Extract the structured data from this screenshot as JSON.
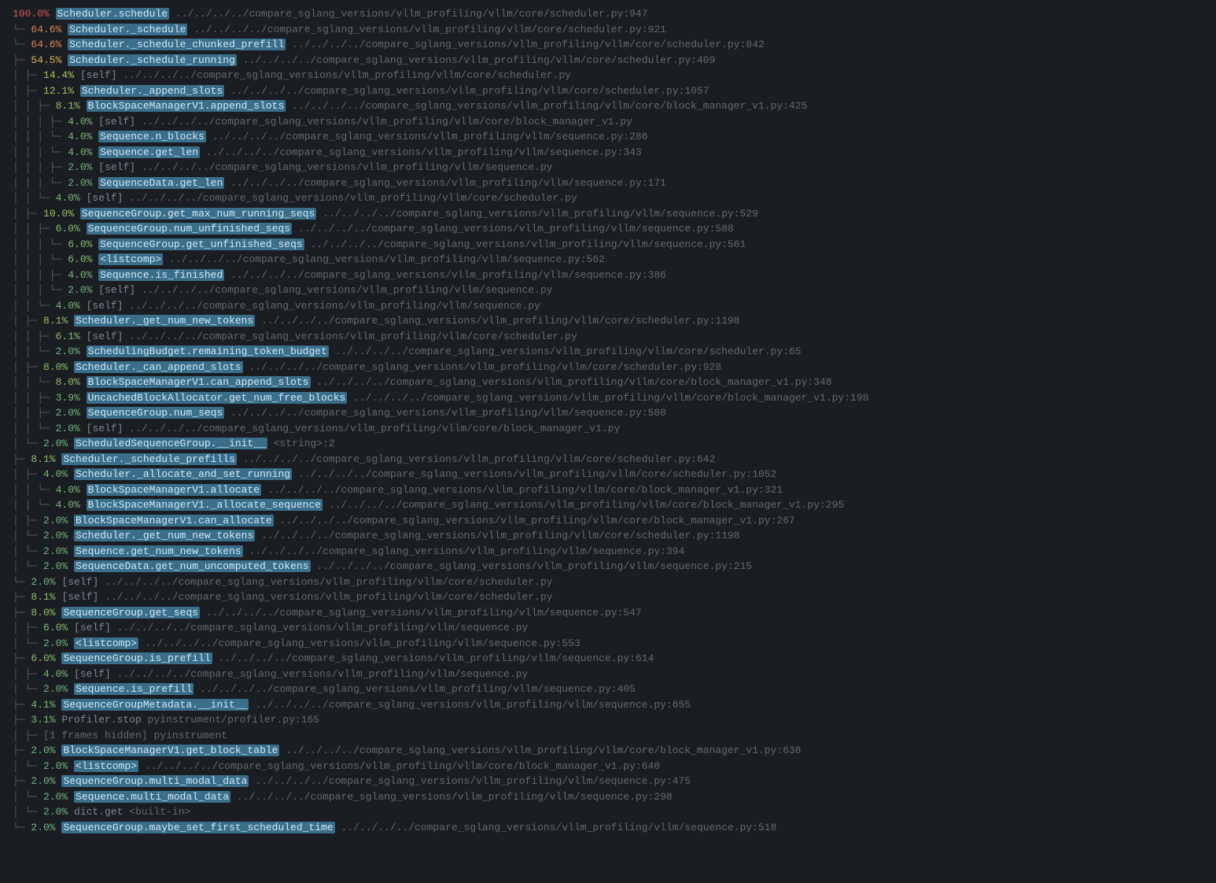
{
  "colors": {
    "pct_100": "#d1565a",
    "pct_64": "#d78a52",
    "pct_54": "#d7ae52",
    "pct_14": "#a7c25c",
    "pct_12": "#a0c160",
    "pct_10": "#9bc065",
    "pct_8": "#90bd6b",
    "pct_6": "#86ba71",
    "pct_4": "#7cb877",
    "pct_3": "#76b67b",
    "pct_2": "#70b480"
  },
  "rows": [
    {
      "depth": 0,
      "last": false,
      "pct": "100.0%",
      "pctKey": "pct_100",
      "func": "Scheduler.schedule",
      "hi": true,
      "loc": "../../../../compare_sglang_versions/vllm_profiling/vllm/core/scheduler.py:947"
    },
    {
      "depth": 1,
      "last": true,
      "pct": "64.6%",
      "pctKey": "pct_64",
      "func": "Scheduler._schedule",
      "hi": true,
      "loc": "../../../../compare_sglang_versions/vllm_profiling/vllm/core/scheduler.py:921"
    },
    {
      "depth": 2,
      "last": true,
      "pct": "64.6%",
      "pctKey": "pct_64",
      "func": "Scheduler._schedule_chunked_prefill",
      "hi": true,
      "loc": "../../../../compare_sglang_versions/vllm_profiling/vllm/core/scheduler.py:842"
    },
    {
      "depth": 3,
      "last": false,
      "pct": "54.5%",
      "pctKey": "pct_54",
      "func": "Scheduler._schedule_running",
      "hi": true,
      "loc": "../../../../compare_sglang_versions/vllm_profiling/vllm/core/scheduler.py:409"
    },
    {
      "depth": 4,
      "last": false,
      "pct": "14.4%",
      "pctKey": "pct_14",
      "func": "[self]",
      "hi": false,
      "loc": "../../../../compare_sglang_versions/vllm_profiling/vllm/core/scheduler.py"
    },
    {
      "depth": 4,
      "last": false,
      "pct": "12.1%",
      "pctKey": "pct_12",
      "func": "Scheduler._append_slots",
      "hi": true,
      "loc": "../../../../compare_sglang_versions/vllm_profiling/vllm/core/scheduler.py:1057"
    },
    {
      "depth": 5,
      "last": false,
      "pct": "8.1%",
      "pctKey": "pct_8",
      "func": "BlockSpaceManagerV1.append_slots",
      "hi": true,
      "loc": "../../../../compare_sglang_versions/vllm_profiling/vllm/core/block_manager_v1.py:425"
    },
    {
      "depth": 6,
      "last": false,
      "pct": "4.0%",
      "pctKey": "pct_4",
      "func": "[self]",
      "hi": false,
      "loc": "../../../../compare_sglang_versions/vllm_profiling/vllm/core/block_manager_v1.py"
    },
    {
      "depth": 6,
      "last": true,
      "pct": "4.0%",
      "pctKey": "pct_4",
      "func": "Sequence.n_blocks",
      "hi": true,
      "loc": "../../../../compare_sglang_versions/vllm_profiling/vllm/sequence.py:286"
    },
    {
      "depth": 7,
      "last": true,
      "pct": "4.0%",
      "pctKey": "pct_4",
      "func": "Sequence.get_len",
      "hi": true,
      "loc": "../../../../compare_sglang_versions/vllm_profiling/vllm/sequence.py:343"
    },
    {
      "depth": 8,
      "last": false,
      "pct": "2.0%",
      "pctKey": "pct_2",
      "func": "[self]",
      "hi": false,
      "loc": "../../../../compare_sglang_versions/vllm_profiling/vllm/sequence.py"
    },
    {
      "depth": 8,
      "last": true,
      "pct": "2.0%",
      "pctKey": "pct_2",
      "func": "SequenceData.get_len",
      "hi": true,
      "loc": "../../../../compare_sglang_versions/vllm_profiling/vllm/sequence.py:171"
    },
    {
      "depth": 5,
      "last": true,
      "pct": "4.0%",
      "pctKey": "pct_4",
      "func": "[self]",
      "hi": false,
      "loc": "../../../../compare_sglang_versions/vllm_profiling/vllm/core/scheduler.py"
    },
    {
      "depth": 4,
      "last": false,
      "pct": "10.0%",
      "pctKey": "pct_10",
      "func": "SequenceGroup.get_max_num_running_seqs",
      "hi": true,
      "loc": "../../../../compare_sglang_versions/vllm_profiling/vllm/sequence.py:529"
    },
    {
      "depth": 5,
      "last": false,
      "pct": "6.0%",
      "pctKey": "pct_6",
      "func": "SequenceGroup.num_unfinished_seqs",
      "hi": true,
      "loc": "../../../../compare_sglang_versions/vllm_profiling/vllm/sequence.py:588"
    },
    {
      "depth": 6,
      "last": true,
      "pct": "6.0%",
      "pctKey": "pct_6",
      "func": "SequenceGroup.get_unfinished_seqs",
      "hi": true,
      "loc": "../../../../compare_sglang_versions/vllm_profiling/vllm/sequence.py:561"
    },
    {
      "depth": 7,
      "last": true,
      "pct": "6.0%",
      "pctKey": "pct_6",
      "func": "<listcomp>",
      "hi": true,
      "loc": "../../../../compare_sglang_versions/vllm_profiling/vllm/sequence.py:562"
    },
    {
      "depth": 8,
      "last": false,
      "pct": "4.0%",
      "pctKey": "pct_4",
      "func": "Sequence.is_finished",
      "hi": true,
      "loc": "../../../../compare_sglang_versions/vllm_profiling/vllm/sequence.py:386"
    },
    {
      "depth": 8,
      "last": true,
      "pct": "2.0%",
      "pctKey": "pct_2",
      "func": "[self]",
      "hi": false,
      "loc": "../../../../compare_sglang_versions/vllm_profiling/vllm/sequence.py"
    },
    {
      "depth": 5,
      "last": true,
      "pct": "4.0%",
      "pctKey": "pct_4",
      "func": "[self]",
      "hi": false,
      "loc": "../../../../compare_sglang_versions/vllm_profiling/vllm/sequence.py"
    },
    {
      "depth": 4,
      "last": false,
      "pct": "8.1%",
      "pctKey": "pct_8",
      "func": "Scheduler._get_num_new_tokens",
      "hi": true,
      "loc": "../../../../compare_sglang_versions/vllm_profiling/vllm/core/scheduler.py:1198"
    },
    {
      "depth": 5,
      "last": false,
      "pct": "6.1%",
      "pctKey": "pct_6",
      "func": "[self]",
      "hi": false,
      "loc": "../../../../compare_sglang_versions/vllm_profiling/vllm/core/scheduler.py"
    },
    {
      "depth": 5,
      "last": true,
      "pct": "2.0%",
      "pctKey": "pct_2",
      "func": "SchedulingBudget.remaining_token_budget",
      "hi": true,
      "loc": "../../../../compare_sglang_versions/vllm_profiling/vllm/core/scheduler.py:65"
    },
    {
      "depth": 4,
      "last": false,
      "pct": "8.0%",
      "pctKey": "pct_8",
      "func": "Scheduler._can_append_slots",
      "hi": true,
      "loc": "../../../../compare_sglang_versions/vllm_profiling/vllm/core/scheduler.py:928"
    },
    {
      "depth": 5,
      "last": true,
      "pct": "8.0%",
      "pctKey": "pct_8",
      "func": "BlockSpaceManagerV1.can_append_slots",
      "hi": true,
      "loc": "../../../../compare_sglang_versions/vllm_profiling/vllm/core/block_manager_v1.py:348"
    },
    {
      "depth": 6,
      "last": false,
      "pct": "3.9%",
      "pctKey": "pct_3",
      "func": "UncachedBlockAllocator.get_num_free_blocks",
      "hi": true,
      "loc": "../../../../compare_sglang_versions/vllm_profiling/vllm/core/block_manager_v1.py:198"
    },
    {
      "depth": 6,
      "last": false,
      "pct": "2.0%",
      "pctKey": "pct_2",
      "func": "SequenceGroup.num_seqs",
      "hi": true,
      "loc": "../../../../compare_sglang_versions/vllm_profiling/vllm/sequence.py:580"
    },
    {
      "depth": 6,
      "last": true,
      "pct": "2.0%",
      "pctKey": "pct_2",
      "func": "[self]",
      "hi": false,
      "loc": "../../../../compare_sglang_versions/vllm_profiling/vllm/core/block_manager_v1.py"
    },
    {
      "depth": 4,
      "last": true,
      "pct": "2.0%",
      "pctKey": "pct_2",
      "func": "ScheduledSequenceGroup.__init__",
      "hi": true,
      "loc": "<string>:2"
    },
    {
      "depth": 3,
      "last": false,
      "pct": "8.1%",
      "pctKey": "pct_8",
      "func": "Scheduler._schedule_prefills",
      "hi": true,
      "loc": "../../../../compare_sglang_versions/vllm_profiling/vllm/core/scheduler.py:642"
    },
    {
      "depth": 4,
      "last": false,
      "pct": "4.0%",
      "pctKey": "pct_4",
      "func": "Scheduler._allocate_and_set_running",
      "hi": true,
      "loc": "../../../../compare_sglang_versions/vllm_profiling/vllm/core/scheduler.py:1052"
    },
    {
      "depth": 5,
      "last": true,
      "pct": "4.0%",
      "pctKey": "pct_4",
      "func": "BlockSpaceManagerV1.allocate",
      "hi": true,
      "loc": "../../../../compare_sglang_versions/vllm_profiling/vllm/core/block_manager_v1.py:321"
    },
    {
      "depth": 6,
      "last": true,
      "pct": "4.0%",
      "pctKey": "pct_4",
      "func": "BlockSpaceManagerV1._allocate_sequence",
      "hi": true,
      "loc": "../../../../compare_sglang_versions/vllm_profiling/vllm/core/block_manager_v1.py:295"
    },
    {
      "depth": 4,
      "last": false,
      "pct": "2.0%",
      "pctKey": "pct_2",
      "func": "BlockSpaceManagerV1.can_allocate",
      "hi": true,
      "loc": "../../../../compare_sglang_versions/vllm_profiling/vllm/core/block_manager_v1.py:267"
    },
    {
      "depth": 4,
      "last": true,
      "pct": "2.0%",
      "pctKey": "pct_2",
      "func": "Scheduler._get_num_new_tokens",
      "hi": true,
      "loc": "../../../../compare_sglang_versions/vllm_profiling/vllm/core/scheduler.py:1198"
    },
    {
      "depth": 5,
      "last": true,
      "pct": "2.0%",
      "pctKey": "pct_2",
      "func": "Sequence.get_num_new_tokens",
      "hi": true,
      "loc": "../../../../compare_sglang_versions/vllm_profiling/vllm/sequence.py:394"
    },
    {
      "depth": 6,
      "last": true,
      "pct": "2.0%",
      "pctKey": "pct_2",
      "func": "SequenceData.get_num_uncomputed_tokens",
      "hi": true,
      "loc": "../../../../compare_sglang_versions/vllm_profiling/vllm/sequence.py:215"
    },
    {
      "depth": 3,
      "last": true,
      "pct": "2.0%",
      "pctKey": "pct_2",
      "func": "[self]",
      "hi": false,
      "loc": "../../../../compare_sglang_versions/vllm_profiling/vllm/core/scheduler.py"
    },
    {
      "depth": 1,
      "last": false,
      "pct": "8.1%",
      "pctKey": "pct_8",
      "func": "[self]",
      "hi": false,
      "loc": "../../../../compare_sglang_versions/vllm_profiling/vllm/core/scheduler.py"
    },
    {
      "depth": 1,
      "last": false,
      "pct": "8.0%",
      "pctKey": "pct_8",
      "func": "SequenceGroup.get_seqs",
      "hi": true,
      "loc": "../../../../compare_sglang_versions/vllm_profiling/vllm/sequence.py:547"
    },
    {
      "depth": 2,
      "last": false,
      "pct": "6.0%",
      "pctKey": "pct_6",
      "func": "[self]",
      "hi": false,
      "loc": "../../../../compare_sglang_versions/vllm_profiling/vllm/sequence.py"
    },
    {
      "depth": 2,
      "last": true,
      "pct": "2.0%",
      "pctKey": "pct_2",
      "func": "<listcomp>",
      "hi": true,
      "loc": "../../../../compare_sglang_versions/vllm_profiling/vllm/sequence.py:553"
    },
    {
      "depth": 1,
      "last": false,
      "pct": "6.0%",
      "pctKey": "pct_6",
      "func": "SequenceGroup.is_prefill",
      "hi": true,
      "loc": "../../../../compare_sglang_versions/vllm_profiling/vllm/sequence.py:614"
    },
    {
      "depth": 2,
      "last": false,
      "pct": "4.0%",
      "pctKey": "pct_4",
      "func": "[self]",
      "hi": false,
      "loc": "../../../../compare_sglang_versions/vllm_profiling/vllm/sequence.py"
    },
    {
      "depth": 2,
      "last": true,
      "pct": "2.0%",
      "pctKey": "pct_2",
      "func": "Sequence.is_prefill",
      "hi": true,
      "loc": "../../../../compare_sglang_versions/vllm_profiling/vllm/sequence.py:405"
    },
    {
      "depth": 1,
      "last": false,
      "pct": "4.1%",
      "pctKey": "pct_4",
      "func": "SequenceGroupMetadata.__init__",
      "hi": true,
      "loc": "../../../../compare_sglang_versions/vllm_profiling/vllm/sequence.py:655"
    },
    {
      "depth": 1,
      "last": false,
      "pct": "3.1%",
      "pctKey": "pct_3",
      "func": "Profiler.stop",
      "hi": false,
      "loc": "pyinstrument/profiler.py:165"
    },
    {
      "depth": 2,
      "last": false,
      "pct": "",
      "pctKey": "",
      "func": "[1 frames hidden]  pyinstrument",
      "hi": false,
      "loc": "",
      "hidden": true
    },
    {
      "depth": 1,
      "last": false,
      "pct": "2.0%",
      "pctKey": "pct_2",
      "func": "BlockSpaceManagerV1.get_block_table",
      "hi": true,
      "loc": "../../../../compare_sglang_versions/vllm_profiling/vllm/core/block_manager_v1.py:638"
    },
    {
      "depth": 2,
      "last": true,
      "pct": "2.0%",
      "pctKey": "pct_2",
      "func": "<listcomp>",
      "hi": true,
      "loc": "../../../../compare_sglang_versions/vllm_profiling/vllm/core/block_manager_v1.py:640"
    },
    {
      "depth": 1,
      "last": false,
      "pct": "2.0%",
      "pctKey": "pct_2",
      "func": "SequenceGroup.multi_modal_data",
      "hi": true,
      "loc": "../../../../compare_sglang_versions/vllm_profiling/vllm/sequence.py:475"
    },
    {
      "depth": 2,
      "last": true,
      "pct": "2.0%",
      "pctKey": "pct_2",
      "func": "Sequence.multi_modal_data",
      "hi": true,
      "loc": "../../../../compare_sglang_versions/vllm_profiling/vllm/sequence.py:298"
    },
    {
      "depth": 3,
      "last": true,
      "pct": "2.0%",
      "pctKey": "pct_2",
      "func": "dict.get",
      "hi": false,
      "loc": "<built-in>"
    },
    {
      "depth": 1,
      "last": true,
      "pct": "2.0%",
      "pctKey": "pct_2",
      "func": "SequenceGroup.maybe_set_first_scheduled_time",
      "hi": true,
      "loc": "../../../../compare_sglang_versions/vllm_profiling/vllm/sequence.py:518"
    }
  ]
}
